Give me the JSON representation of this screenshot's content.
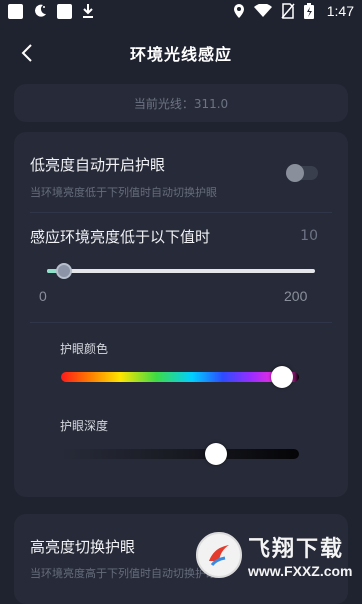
{
  "status_bar": {
    "time": "1:47",
    "left_icons": [
      "square-icon",
      "moon-icon",
      "square-icon",
      "download-icon"
    ],
    "right_icons": [
      "location-icon",
      "wifi-icon",
      "no-sim-icon",
      "battery-charging-icon"
    ]
  },
  "header": {
    "title": "环境光线感应",
    "back_icon": "chevron-left-icon"
  },
  "light_card": {
    "text": "当前光线：311.0"
  },
  "settings": {
    "low_brightness": {
      "title": "低亮度自动开启护眼",
      "subtitle": "当环境亮度低于下列值时自动切换护眼",
      "enabled": false
    },
    "threshold": {
      "title": "感应环境亮度低于以下值时",
      "value": "10",
      "min": "0",
      "max": "200",
      "fraction": 0.05
    },
    "color": {
      "label": "护眼颜色",
      "fraction": 0.93
    },
    "depth": {
      "label": "护眼深度",
      "fraction": 0.65
    }
  },
  "high_brightness": {
    "title": "高亮度切换护眼",
    "subtitle": "当环境亮度高于下列值时自动切换护眼"
  },
  "watermark": {
    "cn": "飞翔下载",
    "en": "www.FXXZ.com"
  },
  "colors": {
    "background": "#1f2330",
    "card": "#272b39",
    "accent": "#8fe0c9"
  }
}
